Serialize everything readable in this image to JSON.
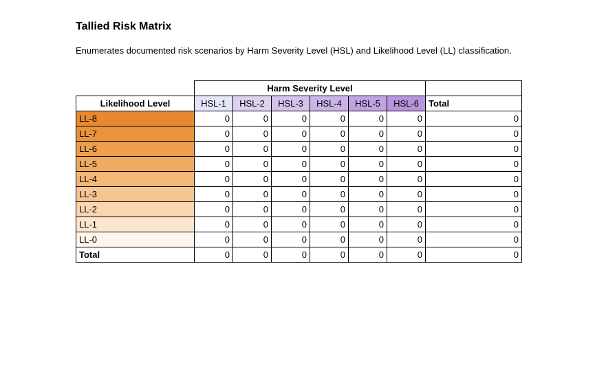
{
  "title": "Tallied Risk Matrix",
  "description": "Enumerates documented risk scenarios by Harm Severity Level (HSL) and Likelihood Level (LL) classification.",
  "superheader": "Harm Severity Level",
  "row_header_title": "Likelihood Level",
  "total_label": "Total",
  "chart_data": {
    "type": "table",
    "title": "Tallied Risk Matrix",
    "columns": [
      "HSL-1",
      "HSL-2",
      "HSL-3",
      "HSL-4",
      "HSL-5",
      "HSL-6"
    ],
    "col_colors": [
      "#e6e6fa",
      "#ded1f0",
      "#d4c2eb",
      "#cab3e6",
      "#c0a4e1",
      "#b695dc"
    ],
    "rows": [
      {
        "label": "LL-8",
        "color": "#e8892f",
        "values": [
          0,
          0,
          0,
          0,
          0,
          0
        ],
        "total": 0
      },
      {
        "label": "LL-7",
        "color": "#ea933e",
        "values": [
          0,
          0,
          0,
          0,
          0,
          0
        ],
        "total": 0
      },
      {
        "label": "LL-6",
        "color": "#ed9e4e",
        "values": [
          0,
          0,
          0,
          0,
          0,
          0
        ],
        "total": 0
      },
      {
        "label": "LL-5",
        "color": "#f0aa60",
        "values": [
          0,
          0,
          0,
          0,
          0,
          0
        ],
        "total": 0
      },
      {
        "label": "LL-4",
        "color": "#f3b776",
        "values": [
          0,
          0,
          0,
          0,
          0,
          0
        ],
        "total": 0
      },
      {
        "label": "LL-3",
        "color": "#f6c692",
        "values": [
          0,
          0,
          0,
          0,
          0,
          0
        ],
        "total": 0
      },
      {
        "label": "LL-2",
        "color": "#f9d6b0",
        "values": [
          0,
          0,
          0,
          0,
          0,
          0
        ],
        "total": 0
      },
      {
        "label": "LL-1",
        "color": "#fce6d0",
        "values": [
          0,
          0,
          0,
          0,
          0,
          0
        ],
        "total": 0
      },
      {
        "label": "LL-0",
        "color": "#fef5ec",
        "values": [
          0,
          0,
          0,
          0,
          0,
          0
        ],
        "total": 0
      }
    ],
    "column_totals": [
      0,
      0,
      0,
      0,
      0,
      0
    ],
    "grand_total": 0
  }
}
